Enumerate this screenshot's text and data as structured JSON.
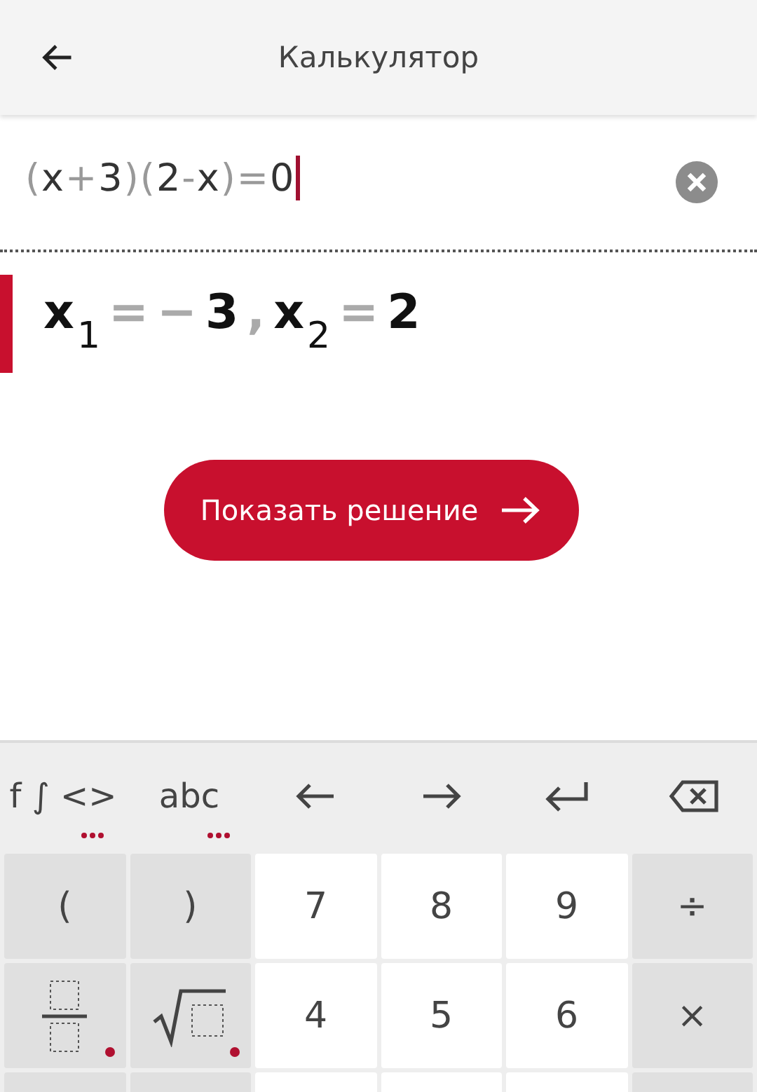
{
  "header": {
    "title": "Калькулятор"
  },
  "expression": {
    "tokens": [
      {
        "text": "(",
        "kind": "op"
      },
      {
        "text": "x",
        "kind": "sym"
      },
      {
        "text": "+",
        "kind": "op"
      },
      {
        "text": "3",
        "kind": "sym"
      },
      {
        "text": ")",
        "kind": "op"
      },
      {
        "text": "(",
        "kind": "op"
      },
      {
        "text": "2",
        "kind": "sym"
      },
      {
        "text": "-",
        "kind": "op"
      },
      {
        "text": "x",
        "kind": "sym"
      },
      {
        "text": ")",
        "kind": "op"
      },
      {
        "text": "=",
        "kind": "op"
      },
      {
        "text": "0",
        "kind": "sym"
      }
    ],
    "cursor": true
  },
  "result": {
    "tokens": [
      {
        "text": "x",
        "kind": "sym"
      },
      {
        "text": "1",
        "kind": "sub"
      },
      {
        "text": "=",
        "kind": "op"
      },
      {
        "text": "−",
        "kind": "op"
      },
      {
        "text": "3",
        "kind": "sym"
      },
      {
        "text": ",",
        "kind": "op"
      },
      {
        "text": "x",
        "kind": "sym"
      },
      {
        "text": "2",
        "kind": "sub"
      },
      {
        "text": "=",
        "kind": "op"
      },
      {
        "text": "2",
        "kind": "sym"
      }
    ]
  },
  "solve_button": {
    "label": "Показать решение"
  },
  "toolbar": [
    {
      "kind": "text",
      "label": "f ∫ <>",
      "more": true
    },
    {
      "kind": "text",
      "label": "abc",
      "more": true
    },
    {
      "kind": "left",
      "more": false
    },
    {
      "kind": "right",
      "more": false
    },
    {
      "kind": "enter",
      "more": false
    },
    {
      "kind": "backspace",
      "more": false
    }
  ],
  "keys": [
    [
      {
        "kind": "function",
        "label": "(",
        "more": false
      },
      {
        "kind": "function",
        "label": ")",
        "more": false
      },
      {
        "kind": "digit",
        "label": "7",
        "more": false
      },
      {
        "kind": "digit",
        "label": "8",
        "more": false
      },
      {
        "kind": "digit",
        "label": "9",
        "more": false
      },
      {
        "kind": "function",
        "label": "÷",
        "more": false
      }
    ],
    [
      {
        "kind": "fraction",
        "more": true
      },
      {
        "kind": "root",
        "more": true
      },
      {
        "kind": "digit",
        "label": "4",
        "more": false
      },
      {
        "kind": "digit",
        "label": "5",
        "more": false
      },
      {
        "kind": "digit",
        "label": "6",
        "more": false
      },
      {
        "kind": "function",
        "label": "×",
        "more": false
      }
    ],
    [
      {
        "kind": "function",
        "more": false
      },
      {
        "kind": "function",
        "more": false
      },
      {
        "kind": "digit",
        "more": false
      },
      {
        "kind": "digit",
        "more": false
      },
      {
        "kind": "digit",
        "more": false
      },
      {
        "kind": "function",
        "more": false
      }
    ]
  ]
}
